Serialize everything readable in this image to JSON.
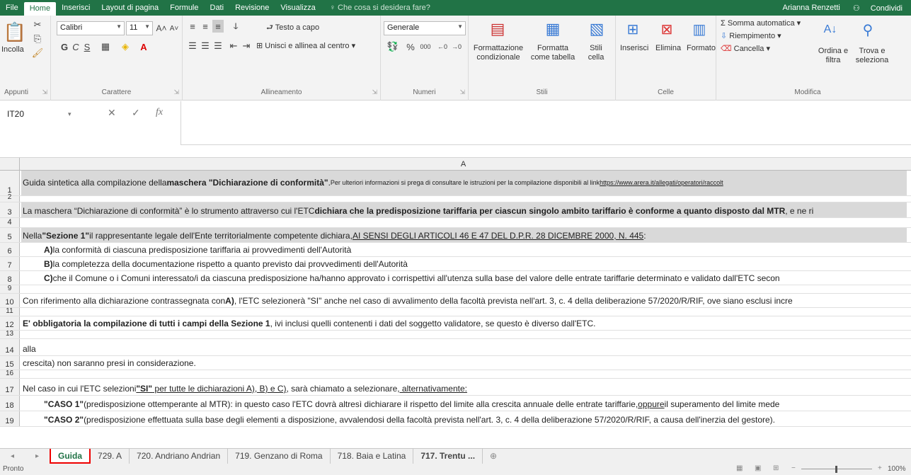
{
  "ribbon_tabs": [
    "File",
    "Home",
    "Inserisci",
    "Layout di pagina",
    "Formule",
    "Dati",
    "Revisione",
    "Visualizza"
  ],
  "tell_me": "Che cosa si desidera fare?",
  "user_name": "Arianna Renzetti",
  "share_label": "Condividi",
  "clipboard": {
    "paste": "Incolla",
    "group": "Appunti"
  },
  "font": {
    "name": "Calibri",
    "size": "11",
    "group": "Carattere"
  },
  "alignment": {
    "wrap": "Testo a capo",
    "merge": "Unisci e allinea al centro",
    "group": "Allineamento"
  },
  "number": {
    "format": "Generale",
    "group": "Numeri"
  },
  "styles": {
    "conditional": "Formattazione condizionale",
    "table": "Formatta come tabella",
    "cell": "Stili cella",
    "group": "Stili"
  },
  "cells": {
    "insert": "Inserisci",
    "delete": "Elimina",
    "format": "Formato",
    "group": "Celle"
  },
  "editing": {
    "autosum": "Somma automatica",
    "fill": "Riempimento",
    "clear": "Cancella",
    "sort": "Ordina e filtra",
    "find": "Trova e seleziona",
    "group": "Modifica"
  },
  "name_box": "IT20",
  "column_header": "A",
  "rows": [
    {
      "n": "1",
      "html_parts": [
        "Guida sintetica alla compilazione della ",
        "maschera \"Dichiarazione di conformità\"",
        ". ",
        "Per ulteriori informazioni si prega di consultare le istruzioni per la compilazione disponibili al link ",
        "https://www.arera.it/allegati/operatori/raccolt"
      ]
    },
    {
      "n": "2"
    },
    {
      "n": "3",
      "p1": "La maschera “Dichiarazione di conformità” è lo strumento attraverso cui l'ETC ",
      "p2": "dichiara che la predisposizione tariffaria per ciascun singolo ambito tariffario è conforme a quanto disposto dal MTR",
      "p3": ", e ne ri"
    },
    {
      "n": "4"
    },
    {
      "n": "5",
      "p1": "Nella ",
      "p2": "\"Sezione 1\"",
      "p3": " il rappresentante legale dell'Ente territorialmente competente dichiara, ",
      "p4": "AI SENSI DEGLI ARTICOLI 46 E 47 DEL D.P.R. 28 DICEMBRE 2000, N. 445",
      "p5": ":"
    },
    {
      "n": "6",
      "b": "A)",
      "t": " la conformità di ciascuna predisposizione tariffaria ai provvedimenti dell'Autorità"
    },
    {
      "n": "7",
      "b": "B)",
      "t": " la completezza della documentazione rispetto a quanto previsto dai provvedimenti dell'Autorità"
    },
    {
      "n": "8",
      "b": "C)",
      "t": " che il Comune o i Comuni interessato/i da ciascuna predisposizione ha/hanno approvato i corrispettivi all'utenza sulla base del valore delle entrate tariffarie determinato e validato dall'ETC secon"
    },
    {
      "n": "9"
    },
    {
      "n": "10",
      "p1": "Con riferimento alla dichiarazione contrassegnata con ",
      "p2": "A)",
      "p3": ", l'ETC selezionerà \"SI\" anche nel caso di avvalimento della facoltà prevista nell'art. 3, c. 4 della deliberazione 57/2020/R/RIF, ove siano esclusi incre"
    },
    {
      "n": "11"
    },
    {
      "n": "12",
      "p1": "E' obbligatoria la compilazione di tutti i campi della Sezione 1",
      "p2": ", ivi inclusi quelli contenenti i dati del soggetto validatore, se questo è diverso dall'ETC."
    },
    {
      "n": "13"
    },
    {
      "n": "14",
      "t": "alla"
    },
    {
      "n": "15",
      "t": "crescita) non saranno presi in considerazione."
    },
    {
      "n": "16"
    },
    {
      "n": "17",
      "p1": "Nel caso in cui l'ETC selezioni ",
      "p2": "\"SI\"",
      "p3": " per tutte le dichiarazioni A), B) e C)",
      "p4": ", sarà chiamato a selezionare",
      "p5": ", alternativamente:"
    },
    {
      "n": "18",
      "p1": "\"CASO 1\"",
      "p2": " (predisposizione ottemperante al MTR): in questo caso l'ETC dovrà altresì dichiarare il rispetto del limite alla crescita annuale delle entrate tariffarie, ",
      "p3": "oppure",
      "p4": " il superamento del limite mede"
    },
    {
      "n": "19",
      "p1": "\"CASO 2\"",
      "p2": " (predisposizione effettuata sulla base degli elementi a disposizione, avvalendosi della facoltà prevista nell'art. 3, c. 4 della deliberazione 57/2020/R/RIF, a causa dell'inerzia del gestore)."
    }
  ],
  "sheet_tabs": [
    "Guida",
    "729. A",
    "720. Andriano Andrian",
    "719. Genzano di Roma",
    "718. Baia e Latina",
    "717. Trentu ..."
  ],
  "status_text": "Pronto",
  "zoom": "100%"
}
